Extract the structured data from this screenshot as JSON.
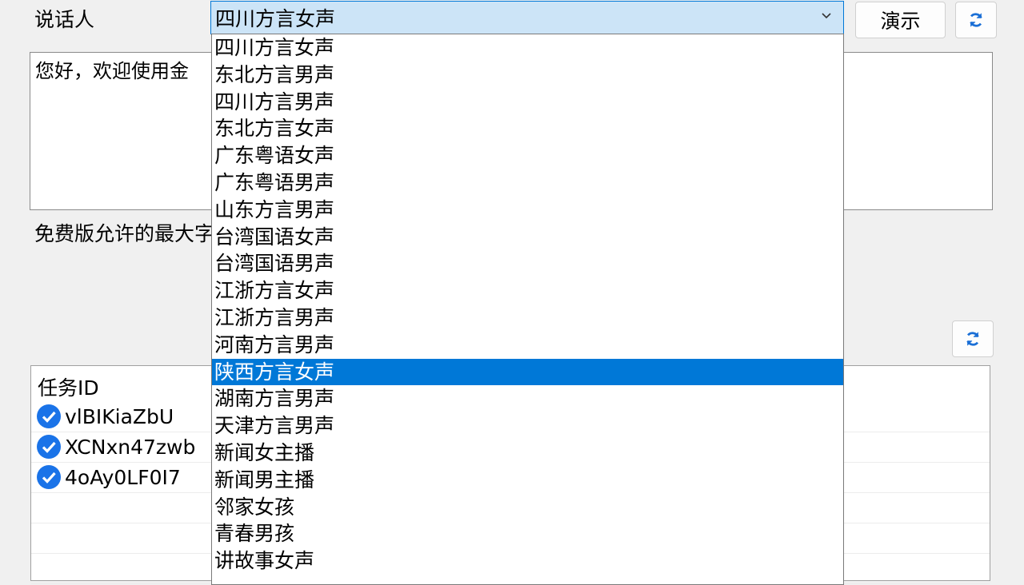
{
  "speaker_label": "说话人",
  "speaker_combo": {
    "selected": "四川方言女声"
  },
  "demo_button": "演示",
  "text_input": {
    "value": "您好，欢迎使用金"
  },
  "free_limit_text": "免费版允许的最大字",
  "task_list": {
    "header": "任务ID",
    "rows": [
      {
        "id": "vlBIKiaZbU",
        "status": "done"
      },
      {
        "id": "XCNxn47zwb",
        "status": "done"
      },
      {
        "id": "4oAy0LF0I7",
        "status": "done"
      }
    ]
  },
  "dropdown": {
    "selected_index": 12,
    "options": [
      "四川方言女声",
      "东北方言男声",
      "四川方言男声",
      "东北方言女声",
      "广东粤语女声",
      "广东粤语男声",
      "山东方言男声",
      "台湾国语女声",
      "台湾国语男声",
      "江浙方言女声",
      "江浙方言男声",
      "河南方言男声",
      "陕西方言女声",
      "湖南方言男声",
      "天津方言男声",
      "新闻女主播",
      "新闻男主播",
      "邻家女孩",
      "青春男孩",
      "讲故事女声"
    ]
  },
  "colors": {
    "accent": "#0078d7",
    "check": "#1a73e8"
  }
}
